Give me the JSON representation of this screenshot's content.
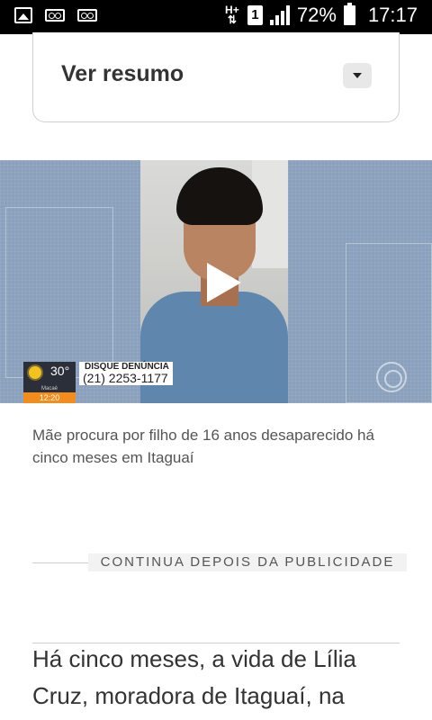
{
  "status_bar": {
    "battery_percent": "72%",
    "time": "17:17",
    "network_type": "H+",
    "sim_slot": "1",
    "icons": [
      "gallery-icon",
      "voicemail-icon",
      "voicemail-icon",
      "hplus-icon",
      "sim-icon",
      "signal-icon",
      "battery-icon"
    ]
  },
  "summary": {
    "title": "Ver resumo",
    "toggle_icon": "chevron-down-icon"
  },
  "video": {
    "play_icon": "play-icon",
    "weather": {
      "temp": "30°",
      "city": "Macaé",
      "time": "12:20"
    },
    "hotline": {
      "title": "DISQUE DENÚNCIA",
      "phone": "(21) 2253-1177"
    },
    "watermark_icon": "globo-icon"
  },
  "caption": "Mãe procura por filho de 16 anos desaparecido há cinco meses em Itaguaí",
  "ad_separator": "CONTINUA DEPOIS DA PUBLICIDADE",
  "article": {
    "first_paragraph": "Há cinco meses, a vida de Lília Cruz, moradora de Itaguaí, na"
  },
  "colors": {
    "status_bar_bg": "#000000",
    "video_bg": "#8aa0bd",
    "weather_time_accent": "#f28c1c"
  }
}
